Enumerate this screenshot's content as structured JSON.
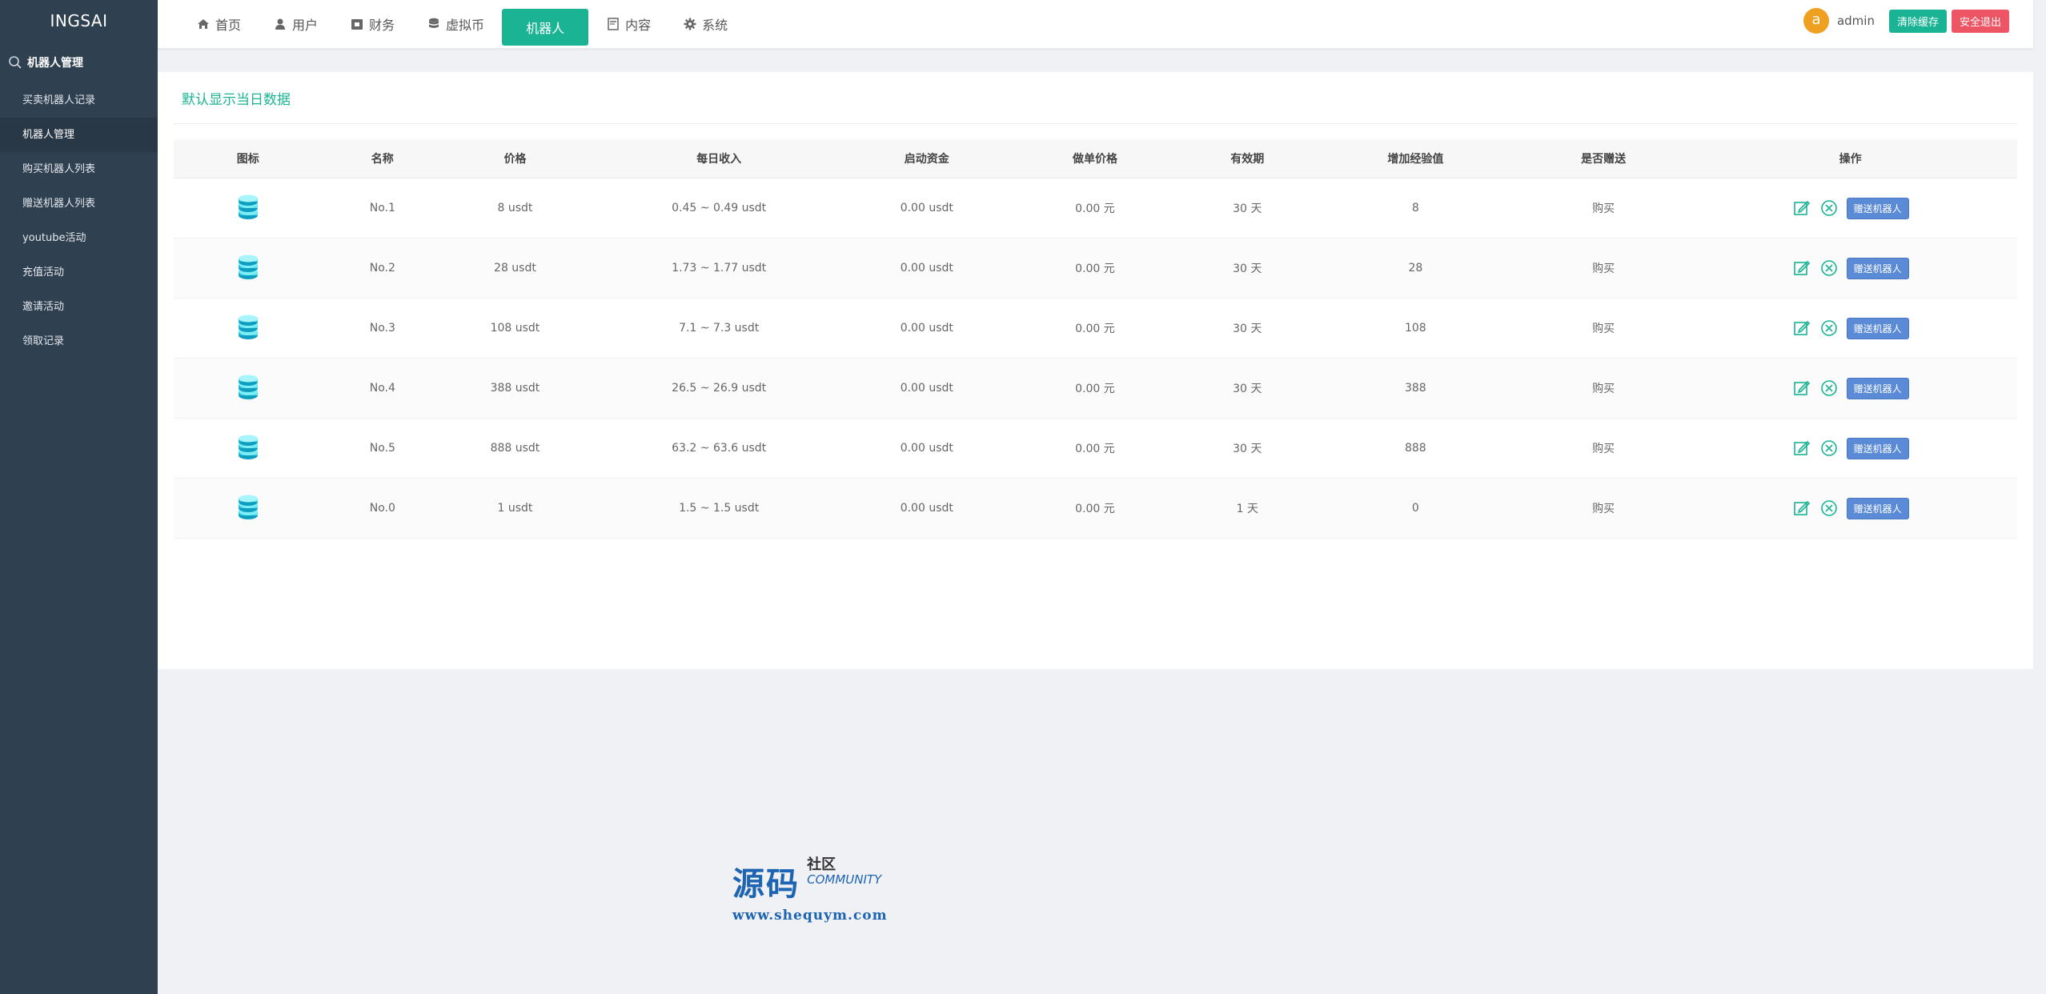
{
  "sidebar": {
    "brand": "INGSAI",
    "section": "机器人管理",
    "items": [
      {
        "label": "买卖机器人记录",
        "active": false
      },
      {
        "label": "机器人管理",
        "active": true
      },
      {
        "label": "购买机器人列表",
        "active": false
      },
      {
        "label": "赠送机器人列表",
        "active": false
      },
      {
        "label": "youtube活动",
        "active": false
      },
      {
        "label": "充值活动",
        "active": false
      },
      {
        "label": "邀请活动",
        "active": false
      },
      {
        "label": "领取记录",
        "active": false
      }
    ]
  },
  "topnav": {
    "items": [
      {
        "label": "首页",
        "icon": "home-icon"
      },
      {
        "label": "用户",
        "icon": "user-icon"
      },
      {
        "label": "财务",
        "icon": "wallet-icon"
      },
      {
        "label": "虚拟币",
        "icon": "database-icon"
      },
      {
        "label": "机器人",
        "icon": "",
        "active": true
      },
      {
        "label": "内容",
        "icon": "document-icon"
      },
      {
        "label": "系统",
        "icon": "gear-icon"
      }
    ],
    "user": {
      "avatar_letter": "a",
      "name": "admin"
    },
    "clear_cache_label": "清除缓存",
    "logout_label": "安全退出"
  },
  "card": {
    "title": "默认显示当日数据"
  },
  "table": {
    "headers": [
      "图标",
      "名称",
      "价格",
      "每日收入",
      "启动资金",
      "做单价格",
      "有效期",
      "增加经验值",
      "是否赠送",
      "操作"
    ],
    "rows": [
      {
        "name": "No.1",
        "price": "8 usdt",
        "daily": "0.45 ~ 0.49 usdt",
        "capital": "0.00 usdt",
        "order_price": "0.00 元",
        "validity": "30 天",
        "exp": "8",
        "gift": "购买"
      },
      {
        "name": "No.2",
        "price": "28 usdt",
        "daily": "1.73 ~ 1.77 usdt",
        "capital": "0.00 usdt",
        "order_price": "0.00 元",
        "validity": "30 天",
        "exp": "28",
        "gift": "购买"
      },
      {
        "name": "No.3",
        "price": "108 usdt",
        "daily": "7.1 ~ 7.3 usdt",
        "capital": "0.00 usdt",
        "order_price": "0.00 元",
        "validity": "30 天",
        "exp": "108",
        "gift": "购买"
      },
      {
        "name": "No.4",
        "price": "388 usdt",
        "daily": "26.5 ~ 26.9 usdt",
        "capital": "0.00 usdt",
        "order_price": "0.00 元",
        "validity": "30 天",
        "exp": "388",
        "gift": "购买"
      },
      {
        "name": "No.5",
        "price": "888 usdt",
        "daily": "63.2 ~ 63.6 usdt",
        "capital": "0.00 usdt",
        "order_price": "0.00 元",
        "validity": "30 天",
        "exp": "888",
        "gift": "购买"
      },
      {
        "name": "No.0",
        "price": "1 usdt",
        "daily": "1.5 ~ 1.5 usdt",
        "capital": "0.00 usdt",
        "order_price": "0.00 元",
        "validity": "1 天",
        "exp": "0",
        "gift": "购买"
      }
    ],
    "action_gift_label": "赠送机器人"
  },
  "watermark": {
    "big": "源码",
    "cn": "社区",
    "en": "COMMUNITY",
    "url": "www.shequym.com"
  },
  "colors": {
    "sidebar_bg": "#2f4050",
    "accent": "#1ab394",
    "danger": "#ed5565",
    "gift_btn": "#5b8bd6"
  }
}
